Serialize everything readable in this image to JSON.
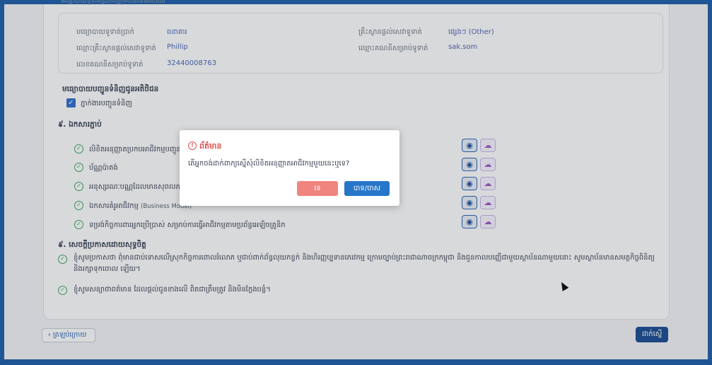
{
  "top_text": "មធ្យោបាយទូទាត់ប្រាក់ពីក្រុមហ៊ុនទៅអតិថិជន",
  "payment_info": {
    "method_label": "មធ្យោបាយទូទាត់ប្រាក់",
    "method_value": "ធនាគារ",
    "provider_label": "គ្រឹះស្ថានផ្តល់សេវាទូទាត់",
    "provider_value": "ផ្សេងៗ (Other)",
    "provider_name_label": "ឈ្មោះគ្រឹះស្ថានផ្តល់សេវាទូទាត់",
    "provider_name_value": "Phillip",
    "account_name_label": "ឈ្មោះគណនីសម្រាប់ទូទាត់",
    "account_name_value": "sak.som",
    "account_number_label": "លេខគណនីសម្រាប់ទូទាត់",
    "account_number_value": "32440008763"
  },
  "delivery": {
    "heading": "មធ្យោបាយបញ្ជូនទំនិញជូនអតិថិជន",
    "checkbox_label": "ភ្នាក់ងារបញ្ជូនទំនិញ",
    "checked": true
  },
  "attachments": {
    "heading": "៩. ឯកសារភ្ជាប់",
    "items": [
      {
        "label": "លិខិតអនុញ្ញាតប្រកបអាជីវកម្មបញ្ជូនទំនិញ"
      },
      {
        "label": "ប័ណ្ណប៉ាតង់"
      },
      {
        "label": "អនុស្សរណៈបណ្ណដែលមានសុពលភាព"
      },
      {
        "label": "ឯកសារគំរូអាជីវកម្ម",
        "extra": "(Business Model)"
      },
      {
        "label": "ទម្រង់កិច្ចការពារអ្នកប្រើប្រាស់ សម្រាប់ការធ្វើអាជីវកម្មតាមប្រព័ន្ធអេឡិចត្រូនិក"
      }
    ]
  },
  "declaration": {
    "heading": "៩. សេចក្តីប្រកាសដោយសុទ្ធចិត្ត",
    "line1": "ខ្ញុំសូមប្រកាសថា ពុំមានជាប់ទោសលើស្រុកកិច្ចការពោលរំលោភ ឬជាប់ពាក់ព័ន្ធលុយកខ្វក់ និងហិរញ្ញប្បទានភេរវកម្ម ក្រោមច្បាប់ព្រះរាជាណាចក្រកម្ពុជា និងជួនកាលបញ្ញើជាមួយស្ថាប័នណាមួយនោះ សូមស្ថាប័នមានសមត្ថកិច្ចពិនិត្យ និងរក្សាទុកចោល",
    "line1_wrap": "ឡើយ។",
    "line2": "ខ្ញុំសូមសន្យាថាពត៌មាន ដែលផ្តល់ជូនខាងលើ ពិតជាត្រឹមត្រូវ និងមិនក្លែងបន្លំ។"
  },
  "footer": {
    "back_label": "ត្រឡប់ក្រោយ",
    "submit_label": "ដាក់ស្នើ"
  },
  "dialog": {
    "title": "ព័ត៌មាន",
    "message": "តើអ្នកចង់ដាក់ពាក្យស្នើសុំលិខិតអនុញ្ញាតអាជីវកម្មមួយនេះឬទេ?",
    "no_label": "ទេ",
    "yes_label": "បាទ/ចាស"
  },
  "colors": {
    "accent": "#1c4d93",
    "success": "#3aa655",
    "danger": "#f0847e"
  }
}
